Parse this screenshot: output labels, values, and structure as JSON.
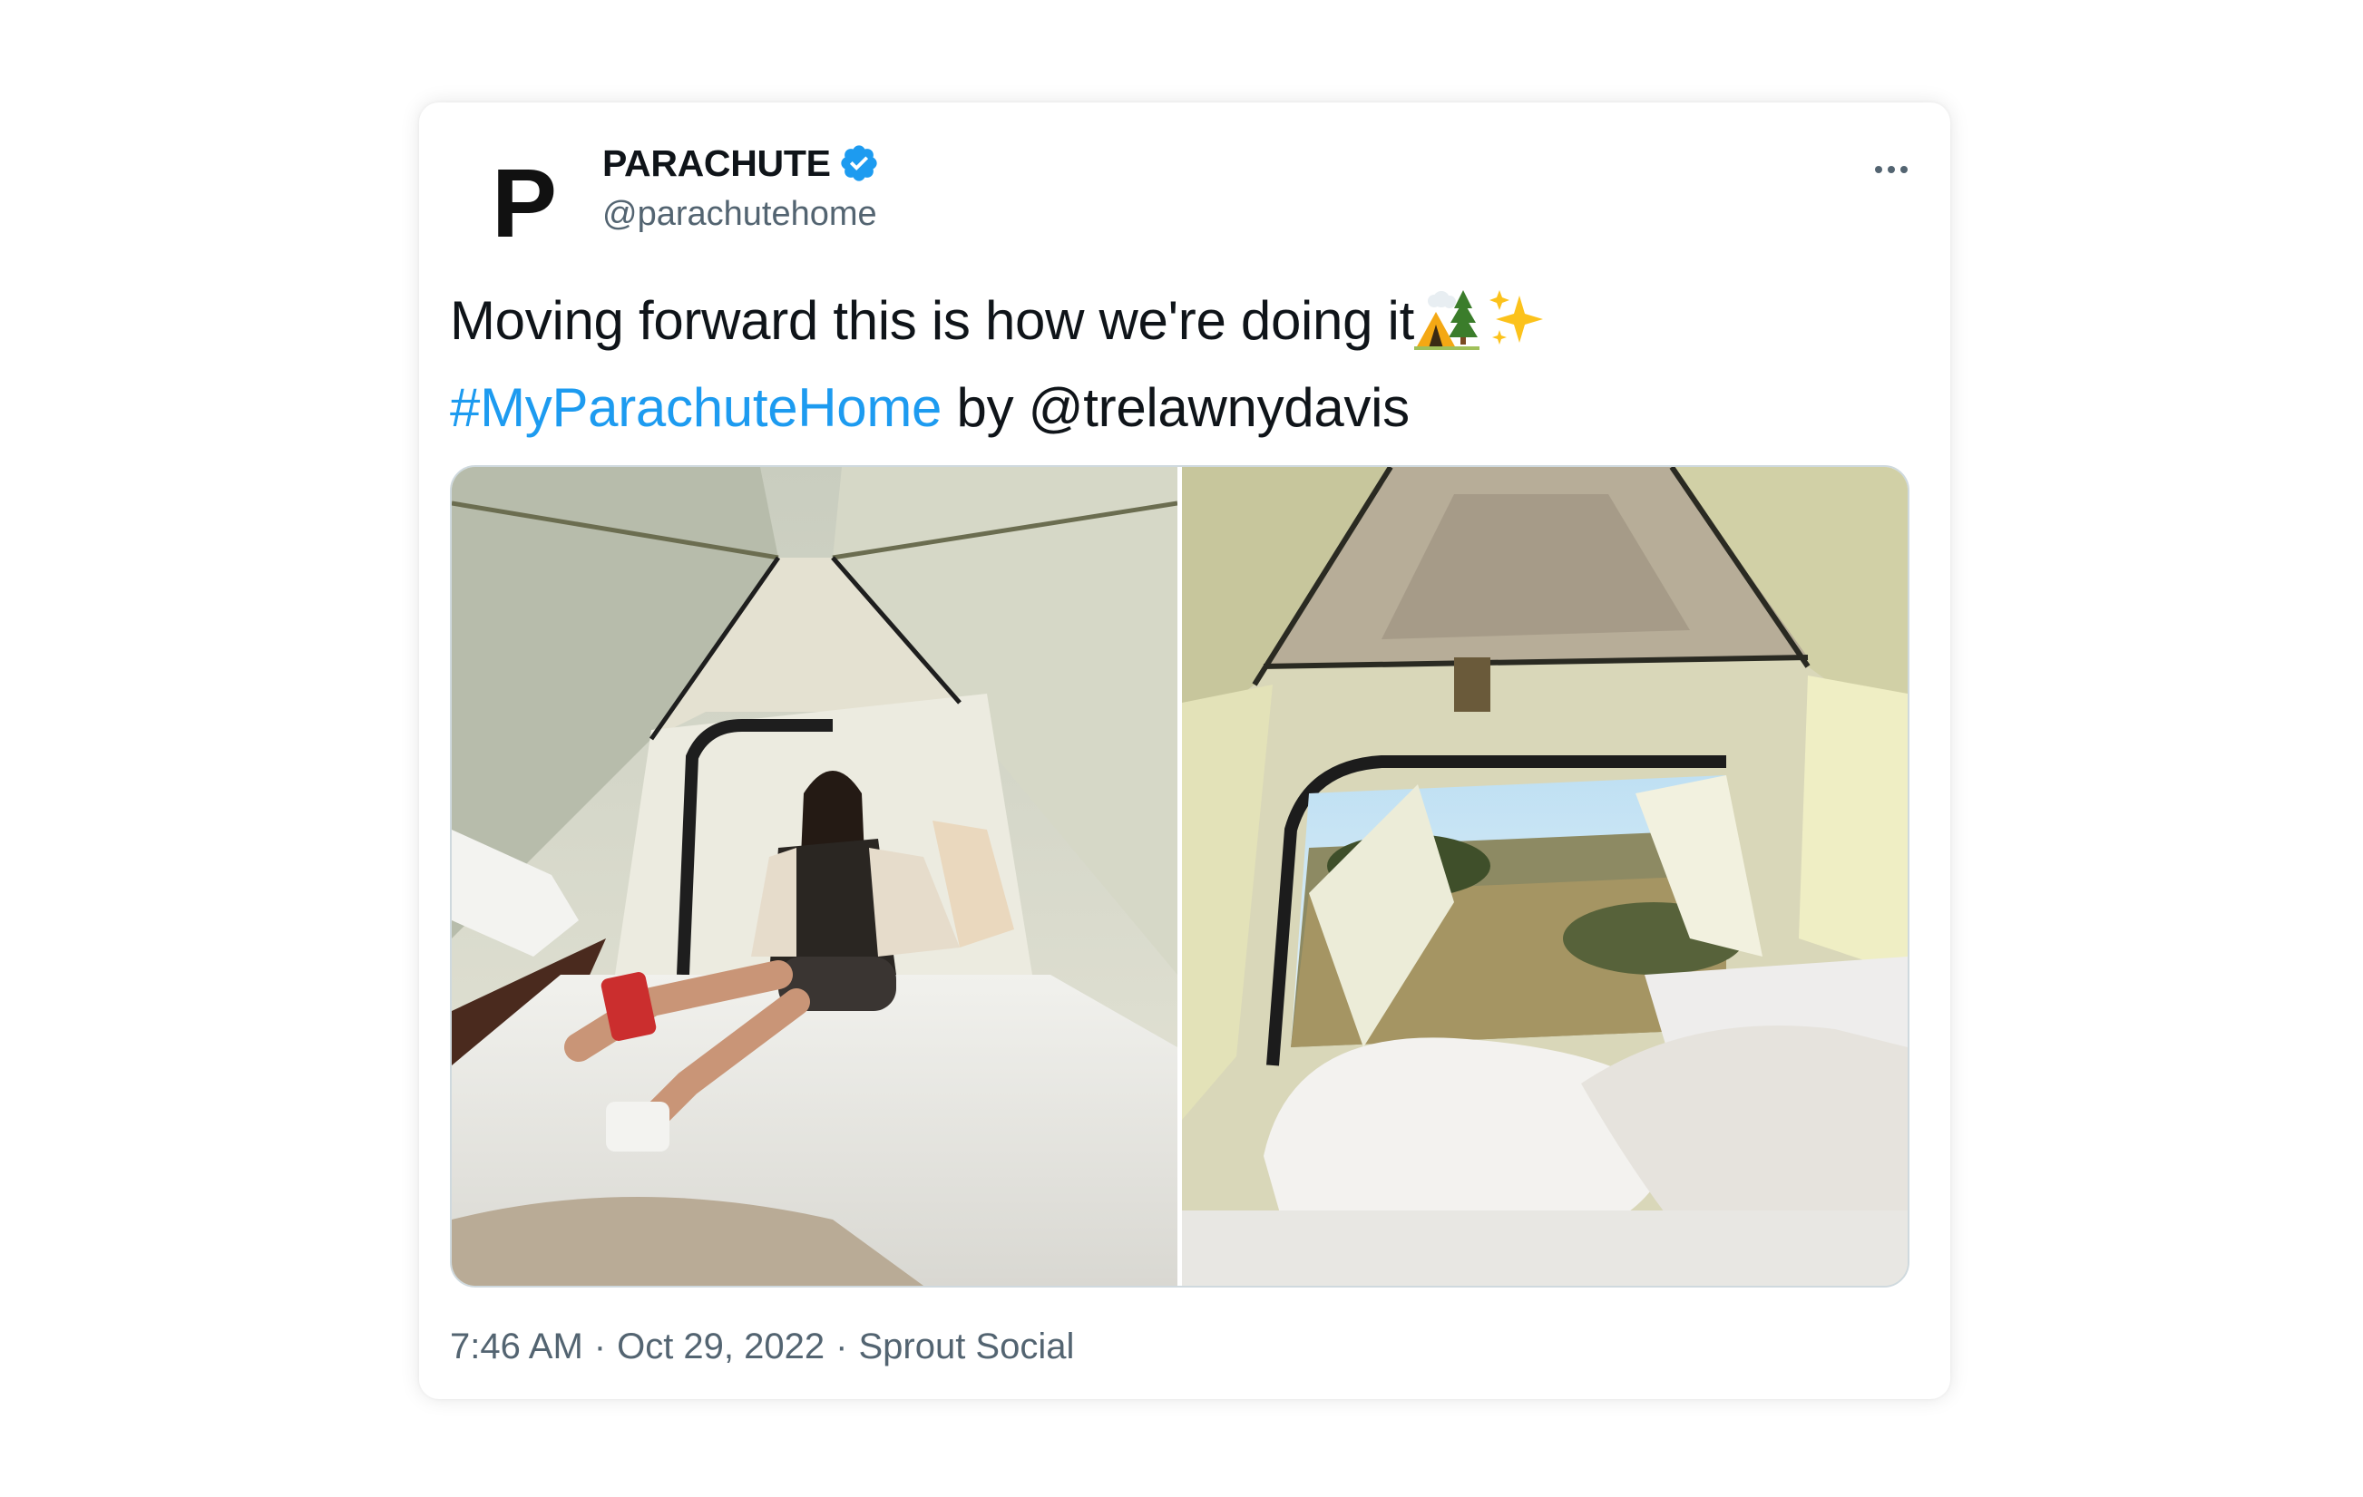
{
  "tweet": {
    "author": {
      "display_name": "PARACHUTE",
      "handle": "@parachutehome",
      "avatar_letter": "P",
      "verified": true,
      "verified_color": "#1d9bf0"
    },
    "text": {
      "line1": "Moving forward this is how we're doing it",
      "line1_emoji": [
        "camping-emoji",
        "sparkles-emoji"
      ],
      "hashtag": "#MyParachuteHome",
      "by_word": "by",
      "mention": "@trelawnydavis"
    },
    "media": [
      {
        "name": "tent-interior-woman-on-bed-photo"
      },
      {
        "name": "tent-door-view-landscape-photo"
      }
    ],
    "footer": {
      "time": "7:46 AM",
      "separator": "·",
      "date": "Oct 29, 2022",
      "source": "Sprout Social"
    },
    "colors": {
      "link": "#1d9bf0",
      "text": "#0f1419",
      "secondary": "#536471"
    }
  }
}
